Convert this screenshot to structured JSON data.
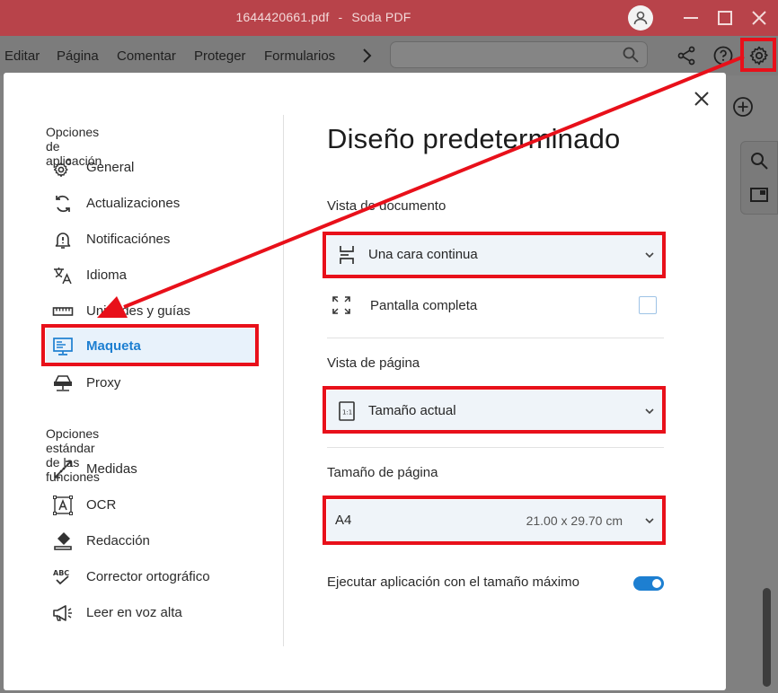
{
  "window": {
    "filename": "1644420661.pdf",
    "app_name": "Soda PDF"
  },
  "menu": {
    "items": [
      "Editar",
      "Página",
      "Comentar",
      "Proteger",
      "Formularios"
    ]
  },
  "search": {
    "value": "",
    "placeholder": ""
  },
  "sidebar": {
    "section1": "Opciones de aplicación",
    "section2": "Opciones estándar de las funciones",
    "items": [
      {
        "label": "General",
        "icon": "gear-icon"
      },
      {
        "label": "Actualizaciones",
        "icon": "refresh-icon"
      },
      {
        "label": "Notificaciónes",
        "icon": "bell-icon"
      },
      {
        "label": "Idioma",
        "icon": "translate-icon"
      },
      {
        "label": "Unidades y guías",
        "icon": "ruler-icon"
      },
      {
        "label": "Maqueta",
        "icon": "layout-icon",
        "active": true
      },
      {
        "label": "Proxy",
        "icon": "proxy-icon"
      }
    ],
    "items2": [
      {
        "label": "Medidas",
        "icon": "measure-icon"
      },
      {
        "label": "OCR",
        "icon": "ocr-icon"
      },
      {
        "label": "Redacción",
        "icon": "eraser-icon"
      },
      {
        "label": "Corrector ortográfico",
        "icon": "spellcheck-icon"
      },
      {
        "label": "Leer en voz alta",
        "icon": "megaphone-icon"
      }
    ]
  },
  "main": {
    "title": "Diseño predeterminado",
    "document_view": {
      "label": "Vista de documento",
      "selected": "Una cara continua"
    },
    "fullscreen": {
      "label": "Pantalla completa",
      "checked": false
    },
    "page_view": {
      "label": "Vista de página",
      "selected": "Tamaño actual"
    },
    "page_size": {
      "label": "Tamaño de página",
      "selected": "A4",
      "dimensions": "21.00 x 29.70 cm"
    },
    "max_size": {
      "label": "Ejecutar aplicación con el tamaño máximo",
      "enabled": true
    }
  },
  "colors": {
    "titlebar": "#b8434a",
    "accent": "#1d7fd1",
    "highlight": "#e8101a"
  }
}
